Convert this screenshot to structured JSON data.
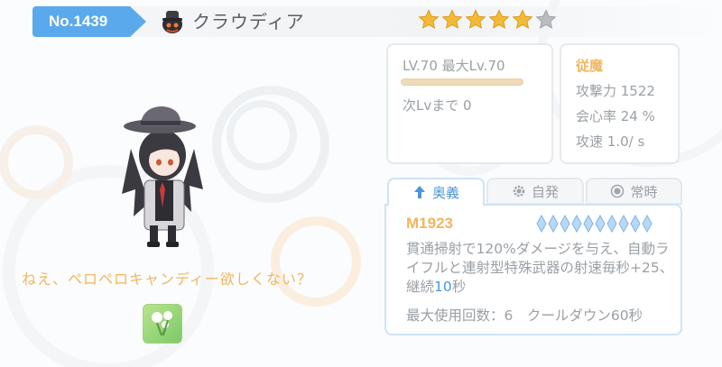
{
  "unit": {
    "number": "No.1439",
    "name": "クラウディア",
    "icon": "hat-character-icon",
    "rarity": 5,
    "max_rarity": 6
  },
  "level": {
    "text": "LV.70 最大Lv.70",
    "progress": 1.0,
    "next": "次Lvまで 0"
  },
  "stats": {
    "title": "従魔",
    "attack": "攻撃力 1522",
    "crit": "会心率 24 %",
    "speed": "攻速 1.0/ s"
  },
  "quote": "ねえ、ペロペロキャンディー欲しくない？",
  "tabs": [
    {
      "label": "奥義",
      "icon": "up-arrow-icon",
      "active": true
    },
    {
      "label": "自発",
      "icon": "gear-icon",
      "active": false
    },
    {
      "label": "常時",
      "icon": "target-icon",
      "active": false
    }
  ],
  "skill": {
    "name": "M1923",
    "gem_count": 10,
    "desc_part1": "貫通掃射で120%ダメージを与え、自動ライフルと連射型特殊武器の射速毎秒+25、継続",
    "desc_highlight": "10",
    "desc_part2": "秒",
    "footer": "最大使用回数：6　クールダウン60秒"
  },
  "colors": {
    "accent_blue": "#5aa9ec",
    "gold": "#f0b660",
    "text_gray": "#9aa0a6"
  }
}
